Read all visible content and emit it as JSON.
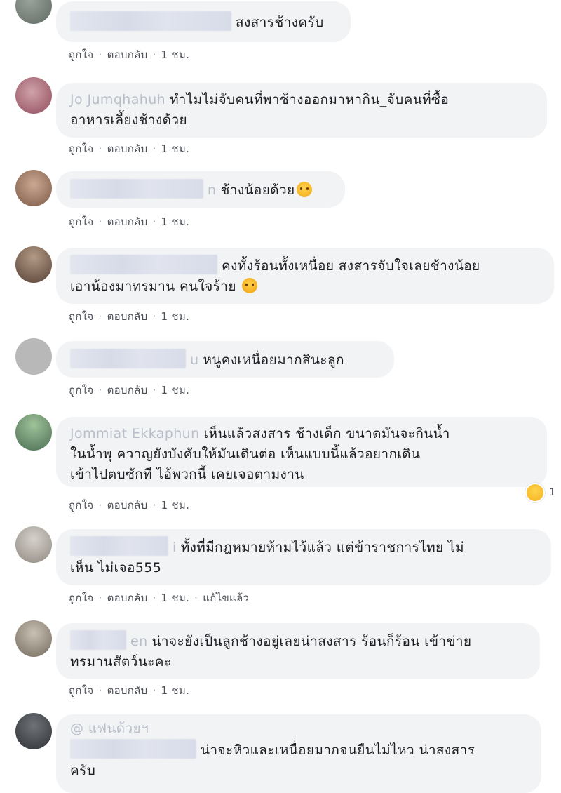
{
  "actions": {
    "like": "ถูกใจ",
    "reply": "ตอบกลับ",
    "sep": "·"
  },
  "comments": [
    {
      "name_visible": "",
      "text": "สงสารช้างครับ",
      "time": "1 ชม.",
      "edited": ""
    },
    {
      "name_visible": "Jo Jumqhahuh",
      "text_line1": "ทำไมไม่จับคนที่พาช้างออกมาหากิน_จับคนที่ซื้อ",
      "text_line2": "อาหารเลี้ยงช้างด้วย",
      "time": "1 ชม."
    },
    {
      "name_visible": "n",
      "text": "ช้างน้อยด้วย",
      "emoji": "sad-face",
      "time": "1 ชม."
    },
    {
      "text_line1": "คงทั้งร้อนทั้งเหนื่อย สงสารจับใจเลยช้างน้อย",
      "text_line2": "เอาน้องมาทรมาน คนใจร้าย",
      "emoji": "crying-face",
      "time": "1 ชม."
    },
    {
      "name_visible": "u",
      "text": "หนูคงเหนื่อยมากสินะลูก",
      "time": "1 ชม."
    },
    {
      "name_visible": "Jommiat Ekkaphun",
      "text_line1": "เห็นแล้วสงสาร ช้างเด็ก ขนาดมันจะกินน้ำ",
      "text_line2": "ในน้ำพุ ควาญยังบังคับให้มันเดินต่อ เห็นแบบนี้แล้วอยากเดิน",
      "text_line3": "เข้าไปตบซักที ไอ้พวกนี้ เคยเจอตามงาน",
      "time": "1 ชม.",
      "reaction_count": "1"
    },
    {
      "name_visible": "i",
      "text_line1": "ทั้งที่มีกฎหมายห้ามไว้แล้ว แต่ข้าราชการไทย ไม่",
      "text_line2": "เห็น ไม่เจอ555",
      "time": "1 ชม.",
      "edited": "แก้ไขแล้ว"
    },
    {
      "name_visible": "en",
      "text_line1": "น่าจะยังเป็นลูกช้างอยู่เลยน่าสงสาร ร้อนก็ร้อน เข้าข่าย",
      "text_line2": "ทรมานสัตว์นะคะ",
      "time": "1 ชม."
    },
    {
      "name_visible": "@ แฟนด้วยฯ",
      "text_line1": "น่าจะหิวและเหนื่อยมากจนยืนไม่ไหว น่าสงสาร",
      "text_line2": "ครับ"
    }
  ]
}
